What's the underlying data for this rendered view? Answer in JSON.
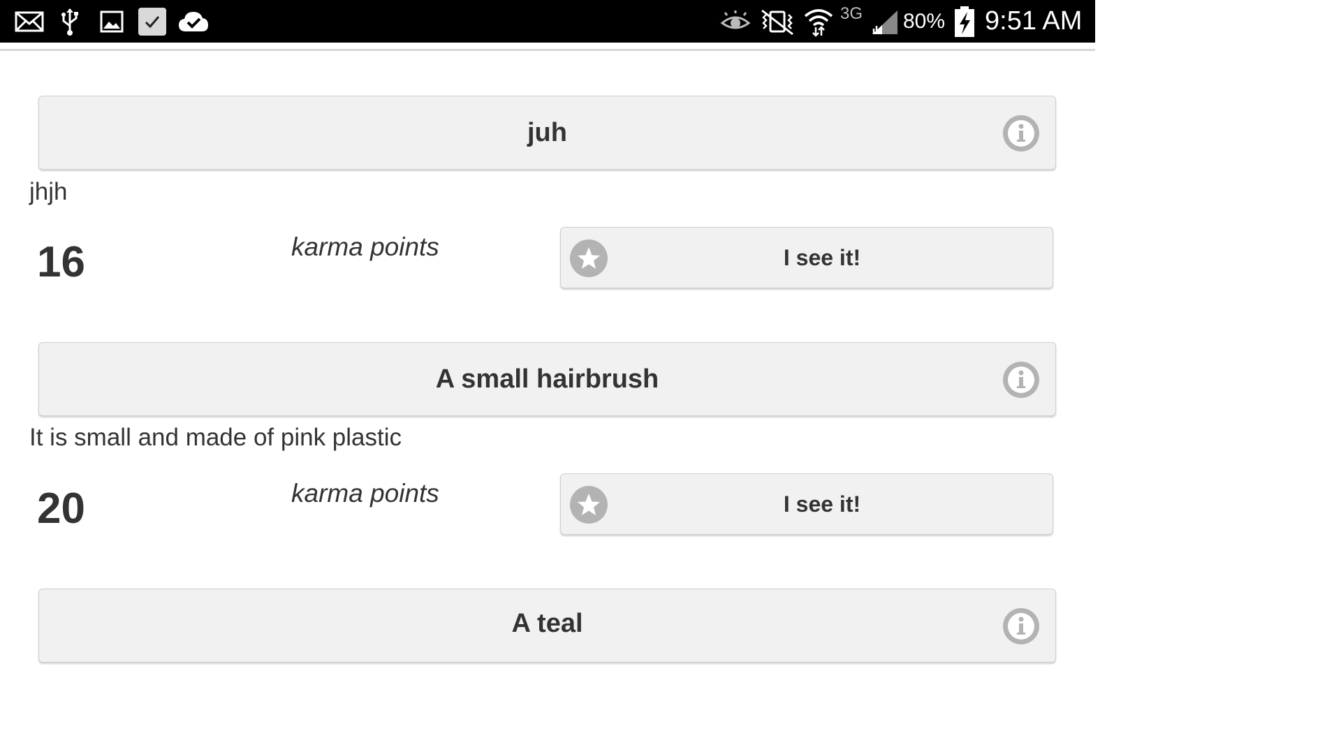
{
  "status_bar": {
    "battery": "80%",
    "time": "9:51 AM",
    "network": "3G",
    "left_icons": [
      "mail-icon",
      "usb-icon",
      "image-icon",
      "checkbox-icon",
      "cloud-check-icon"
    ],
    "right_icons": [
      "eye-icon",
      "vibrate-icon",
      "wifi-icon",
      "signal-icon",
      "battery-charging-icon"
    ]
  },
  "items": [
    {
      "title": "juh",
      "description": "jhjh",
      "points": "16",
      "points_label": "karma points",
      "action_label": "I see it!"
    },
    {
      "title": "A small hairbrush",
      "description": "It is small and made of pink plastic",
      "points": "20",
      "points_label": "karma points",
      "action_label": "I see it!"
    },
    {
      "title": "A teal"
    }
  ],
  "colors": {
    "statusbar_bg": "#000000",
    "card_bg": "#f1f1f1",
    "icon_gray": "#b3b3b3",
    "text": "#333333"
  }
}
